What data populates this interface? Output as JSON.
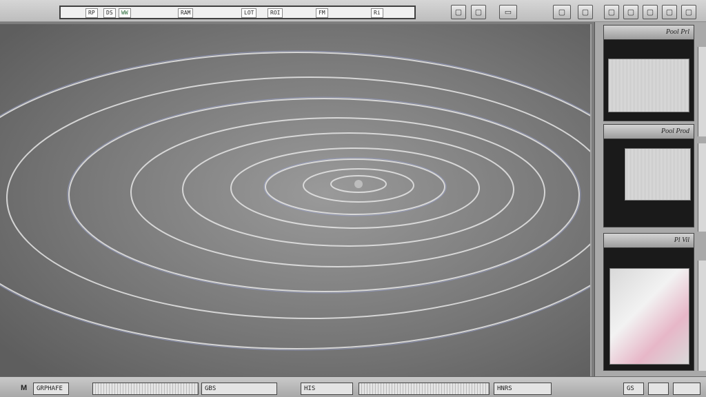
{
  "toolbar": {
    "address_segments": [
      "RP",
      "DS",
      "WW",
      "RAM",
      "LOT",
      "ROI",
      "FM",
      "Ri"
    ],
    "button_icons": [
      "window-icon",
      "window-icon",
      "window-icon",
      "window-icon",
      "window-icon",
      "window-icon",
      "window-icon",
      "window-icon",
      "window-icon"
    ]
  },
  "viewer": {
    "content": "grayscale contour / ripple image"
  },
  "sidebar": {
    "panels": [
      {
        "header": "Pool Prl"
      },
      {
        "header": "Pool Prod"
      },
      {
        "header": "Pl Vil"
      }
    ]
  },
  "statusbar": {
    "left_label": "M",
    "field_1": "GRPHAFE",
    "field_2": "GBS",
    "field_3": "HIS",
    "field_4": "HNRS",
    "field_5": "GS"
  },
  "colors": {
    "chrome": "#c9c9c9",
    "viewer_bg": "#6f6f6f",
    "contour": "#e6e6e6",
    "accent_blue": "#9aa4d8"
  }
}
